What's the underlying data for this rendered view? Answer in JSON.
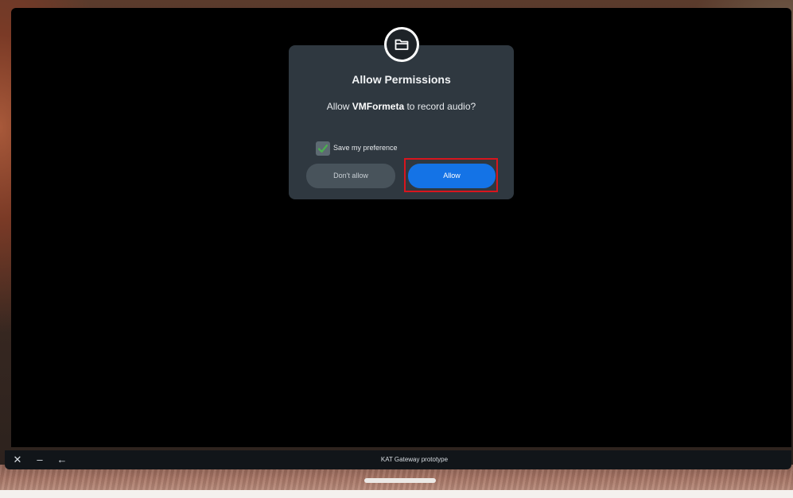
{
  "dialog": {
    "icon": "folder-icon",
    "title": "Allow Permissions",
    "message_prefix": "Allow ",
    "app_name": "VMFormeta",
    "message_suffix": " to record audio?",
    "checkbox_label": "Save my preference",
    "checkbox_checked": true,
    "deny_label": "Don't allow",
    "allow_label": "Allow"
  },
  "taskbar": {
    "title": "KAT Gateway prototype",
    "close_icon": "close-icon",
    "minimize_icon": "minimize-icon",
    "back_icon": "back-arrow-icon"
  },
  "colors": {
    "dialog_bg": "#2f3840",
    "allow_button": "#1473e6",
    "deny_button": "#48535b",
    "checkmark": "#4caf50",
    "highlight": "#d8151d"
  }
}
